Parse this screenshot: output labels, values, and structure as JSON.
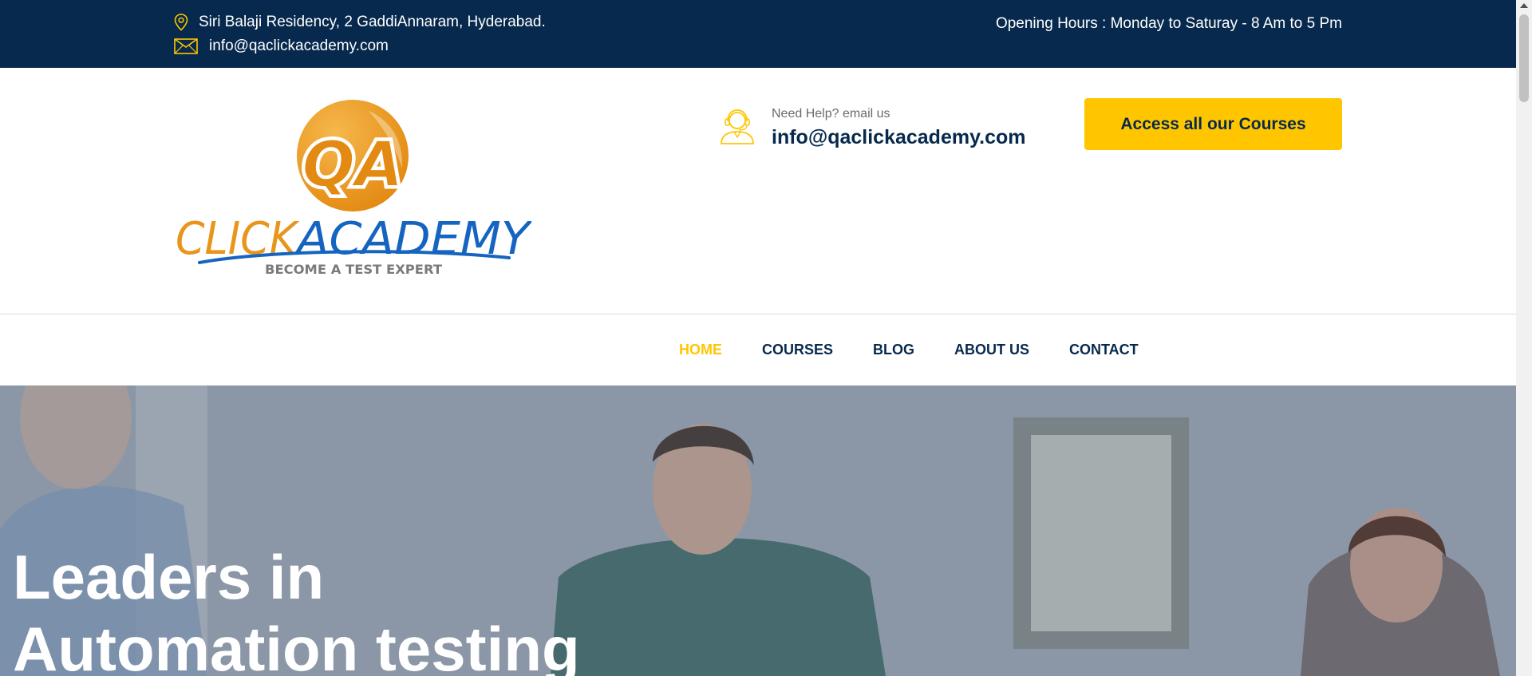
{
  "topbar": {
    "address": "Siri Balaji Residency, 2 GaddiAnnaram, Hyderabad.",
    "email": "info@qaclickacademy.com",
    "hours": "Opening Hours : Monday to Saturay - 8 Am to 5 Pm",
    "address_icon": "map-pin-icon",
    "email_icon": "envelope-icon"
  },
  "header": {
    "logo": {
      "mark": "QA",
      "word_click": "CLICK",
      "word_academy": "ACADEMY",
      "tagline": "BECOME A TEST EXPERT"
    },
    "help_label": "Need Help? email us",
    "help_email": "info@qaclickacademy.com",
    "help_icon": "support-agent-icon",
    "cta_label": "Access all our Courses"
  },
  "nav": {
    "items": [
      {
        "label": "HOME",
        "active": true
      },
      {
        "label": "COURSES",
        "active": false
      },
      {
        "label": "BLOG",
        "active": false
      },
      {
        "label": "ABOUT US",
        "active": false
      },
      {
        "label": "CONTACT",
        "active": false
      }
    ]
  },
  "hero": {
    "title_line1": "Leaders in",
    "title_line2": "Automation testing"
  },
  "colors": {
    "navy": "#07294d",
    "accent_yellow": "#ffc600",
    "logo_orange": "#e8951c",
    "logo_blue": "#1565c0"
  }
}
